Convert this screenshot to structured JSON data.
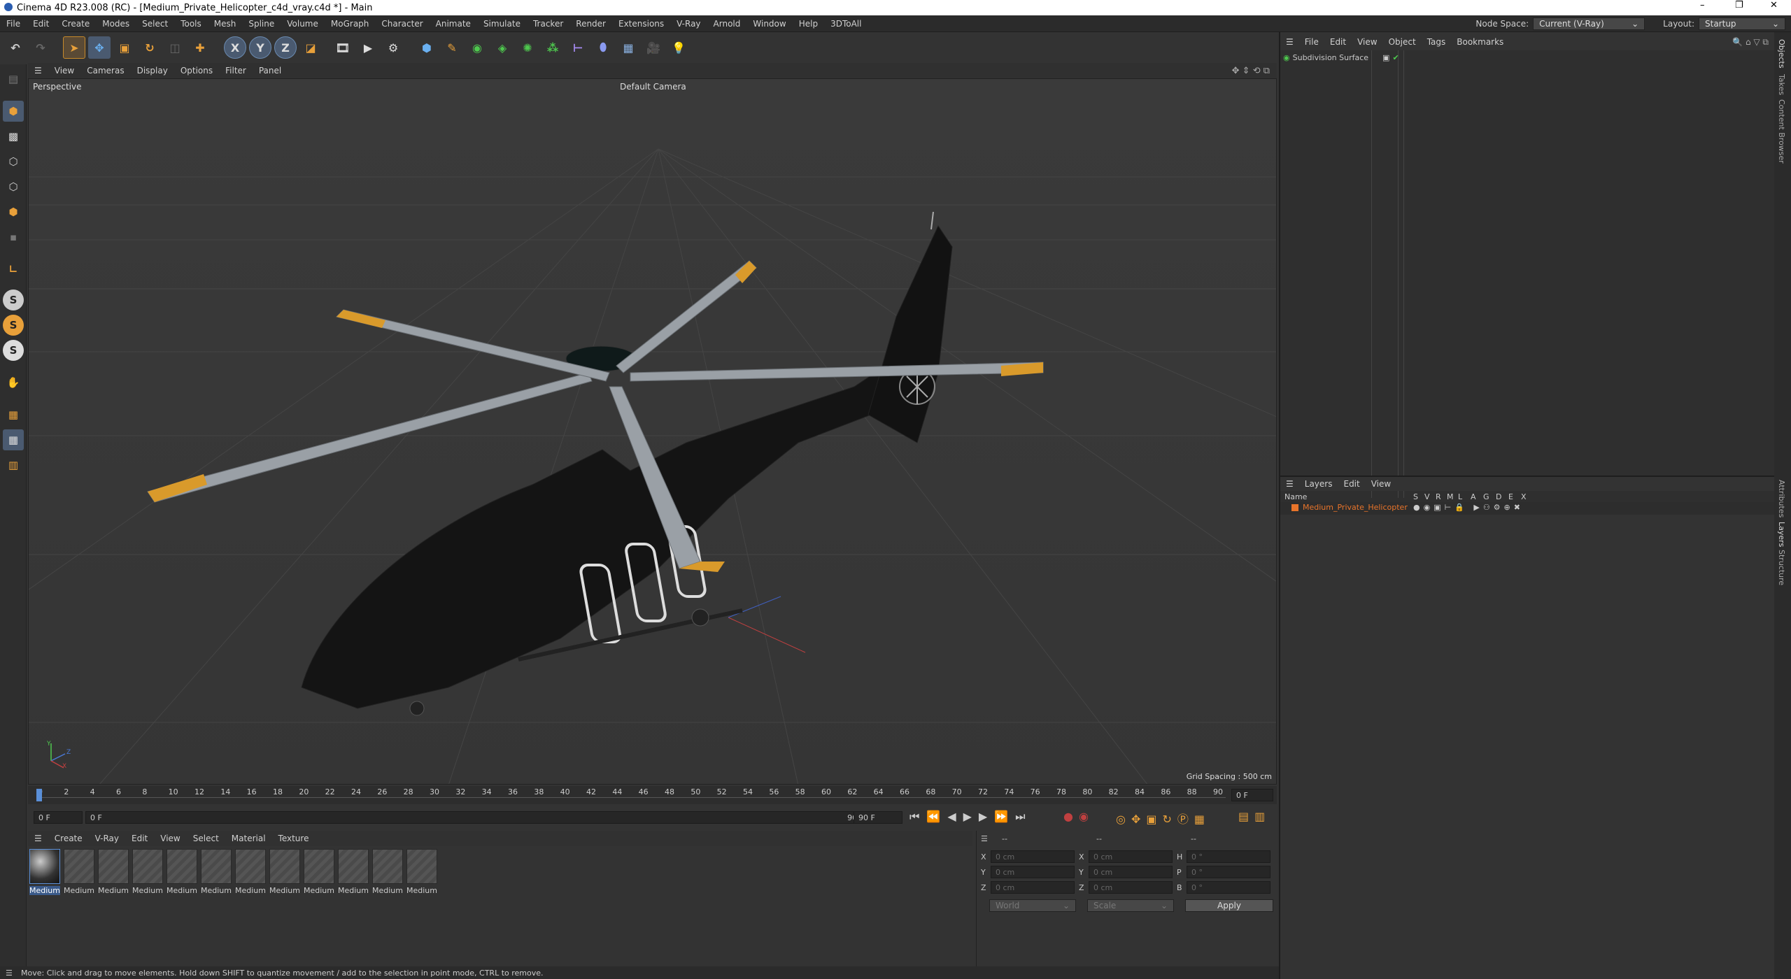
{
  "window": {
    "title": "Cinema 4D R23.008 (RC) - [Medium_Private_Helicopter_c4d_vray.c4d *] - Main",
    "minimize": "–",
    "maximize": "❐",
    "close": "✕"
  },
  "menu": [
    "File",
    "Edit",
    "Create",
    "Modes",
    "Select",
    "Tools",
    "Mesh",
    "Spline",
    "Volume",
    "MoGraph",
    "Character",
    "Animate",
    "Simulate",
    "Tracker",
    "Render",
    "Extensions",
    "V-Ray",
    "Arnold",
    "Window",
    "Help",
    "3DToAll"
  ],
  "node_space": {
    "label": "Node Space:",
    "value": "Current (V-Ray)"
  },
  "layout": {
    "label": "Layout:",
    "value": "Startup"
  },
  "toolbar": {
    "axis_x": "X",
    "axis_y": "Y",
    "axis_z": "Z"
  },
  "left_tools": {
    "s1": "S",
    "s2": "S",
    "s3": "S"
  },
  "viewport": {
    "menu": [
      "View",
      "Cameras",
      "Display",
      "Options",
      "Filter",
      "Panel"
    ],
    "label": "Perspective",
    "camera": "Default Camera",
    "grid_spacing": "Grid Spacing : 500 cm",
    "axis_y": "Y",
    "axis_z": "Z",
    "axis_x": "X"
  },
  "timeline": {
    "ticks": [
      "0",
      "2",
      "4",
      "6",
      "8",
      "10",
      "12",
      "14",
      "16",
      "18",
      "20",
      "22",
      "24",
      "26",
      "28",
      "30",
      "32",
      "34",
      "36",
      "38",
      "40",
      "42",
      "44",
      "46",
      "48",
      "50",
      "52",
      "54",
      "56",
      "58",
      "60",
      "62",
      "64",
      "66",
      "68",
      "70",
      "72",
      "74",
      "76",
      "78",
      "80",
      "82",
      "84",
      "86",
      "88",
      "90"
    ],
    "current_frame": "0 F",
    "start": "0 F",
    "range_start": "0 F",
    "range_end": "90 F",
    "end": "90 F"
  },
  "material": {
    "menu": [
      "Create",
      "V-Ray",
      "Edit",
      "View",
      "Select",
      "Material",
      "Texture"
    ],
    "items": [
      "Medium",
      "Medium",
      "Medium",
      "Medium",
      "Medium",
      "Medium",
      "Medium",
      "Medium",
      "Medium",
      "Medium",
      "Medium",
      "Medium"
    ]
  },
  "coords": {
    "header1": "--",
    "header2": "--",
    "header3": "--",
    "rows": [
      {
        "a": "X",
        "av": "0 cm",
        "b": "X",
        "bv": "0 cm",
        "c": "H",
        "cv": "0 °"
      },
      {
        "a": "Y",
        "av": "0 cm",
        "b": "Y",
        "bv": "0 cm",
        "c": "P",
        "cv": "0 °"
      },
      {
        "a": "Z",
        "av": "0 cm",
        "b": "Z",
        "bv": "0 cm",
        "c": "B",
        "cv": "0 °"
      }
    ],
    "world": "World",
    "scale": "Scale",
    "apply": "Apply"
  },
  "objects": {
    "menu": [
      "File",
      "Edit",
      "View",
      "Object",
      "Tags",
      "Bookmarks"
    ],
    "items": [
      {
        "name": "Subdivision Surface"
      }
    ]
  },
  "layers": {
    "menu": [
      "Layers",
      "Edit",
      "View"
    ],
    "header_name": "Name",
    "header_flags": [
      "S",
      "V",
      "R",
      "M",
      "L",
      "A",
      "G",
      "D",
      "E",
      "X"
    ],
    "items": [
      {
        "name": "Medium_Private_Helicopter",
        "color": "#e8742a"
      }
    ]
  },
  "side_tabs": [
    "Objects",
    "Takes",
    "Content Browser",
    "Attributes",
    "Layers",
    "Structure"
  ],
  "status": "Move: Click and drag to move elements. Hold down SHIFT to quantize movement / add to the selection in point mode, CTRL to remove.",
  "colors": {
    "accent": "#4a8fd8",
    "orange": "#e8742a",
    "heli_tips": "#d99a2b"
  }
}
